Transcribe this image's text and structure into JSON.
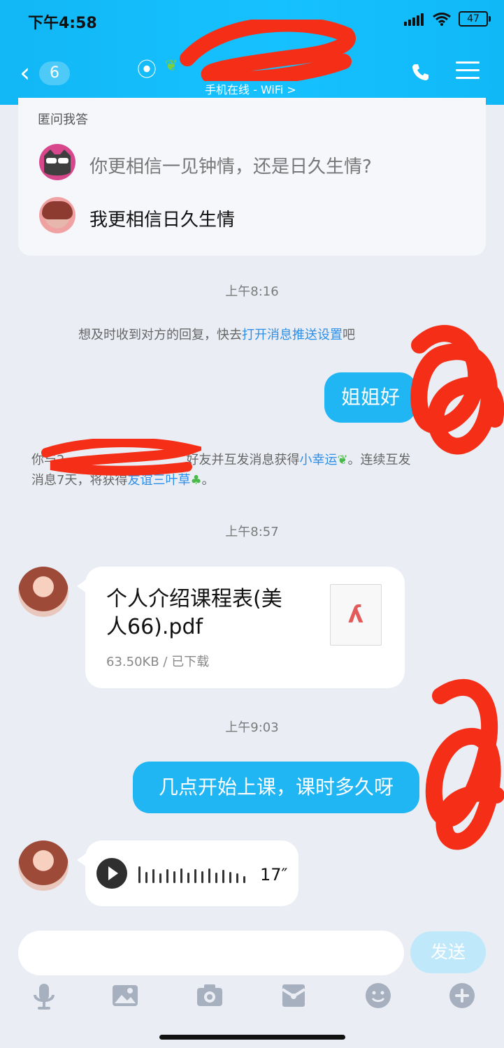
{
  "status_bar": {
    "time": "下午4:58",
    "battery": "47"
  },
  "header": {
    "back_count": "6",
    "subtitle": "手机在线 - WiFi >"
  },
  "qa_card": {
    "title": "匿问我答",
    "question": "你更相信一见钟情，还是日久生情?",
    "answer": "我更相信日久生情"
  },
  "messages": {
    "t1": "上午8:16",
    "notice_1_prefix": "想及时收到对方的回复，快去",
    "notice_1_link": "打开消息推送设置",
    "notice_1_suffix": "吧",
    "my_greeting": "姐姐好",
    "notice_2_prefix": "你与2",
    "notice_2_mid": "好友并互发消息获得",
    "notice_2_link_1": "小幸运",
    "notice_2_mid2": "。连续互发",
    "notice_2_line2_prefix": "消息7天，将获得",
    "notice_2_link_2": "友谊三叶草",
    "notice_2_suffix": "。",
    "t2": "上午8:57",
    "file_name_line1": "个人介绍课程表(美",
    "file_name_line2": "人66).pdf",
    "file_meta": "63.50KB / 已下载",
    "t3": "上午9:03",
    "my_question": "几点开始上课，课时多久呀",
    "voice_duration": "17″"
  },
  "composer": {
    "send_label": "发送"
  }
}
